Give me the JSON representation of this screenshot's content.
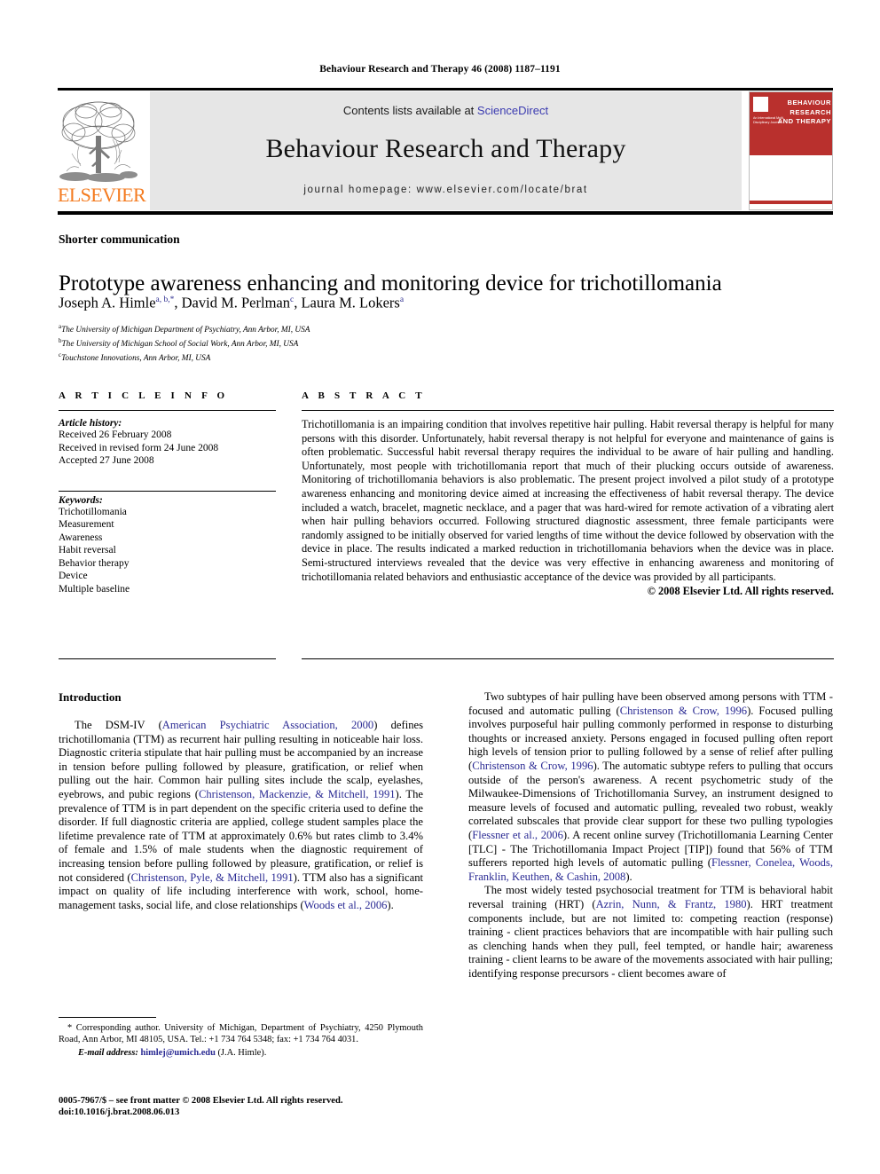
{
  "running_head": "Behaviour Research and Therapy 46 (2008) 1187–1191",
  "masthead": {
    "contents_prefix": "Contents lists available at ",
    "sciencedirect": "ScienceDirect",
    "journal_title": "Behaviour Research and Therapy",
    "homepage": "journal homepage: www.elsevier.com/locate/brat",
    "publisher_wordmark": "ELSEVIER",
    "cover_title": "BEHAVIOUR RESEARCH AND THERAPY",
    "cover_sub": "An International Multi-Disciplinary Journal",
    "colors": {
      "cover_red": "#b9302d",
      "elsevier_orange": "#F47B20",
      "link_blue": "#3b3bb0",
      "panel_gray": "#e6e6e6"
    }
  },
  "article": {
    "section_kind": "Shorter communication",
    "title": "Prototype awareness enhancing and monitoring device for trichotillomania",
    "authors_html": "Joseph A. Himle<sup>a, b,</sup><sup>*</sup>, David M. Perlman<sup>c</sup>, Laura M. Lokers<sup>a</sup>",
    "affiliations": [
      {
        "marker": "a",
        "text": "The University of Michigan Department of Psychiatry, Ann Arbor, MI, USA"
      },
      {
        "marker": "b",
        "text": "The University of Michigan School of Social Work, Ann Arbor, MI, USA"
      },
      {
        "marker": "c",
        "text": "Touchstone Innovations, Ann Arbor, MI, USA"
      }
    ]
  },
  "article_info": {
    "heading": "A R T I C L E    I N F O",
    "history_label": "Article history:",
    "history": [
      "Received 26 February 2008",
      "Received in revised form 24 June 2008",
      "Accepted 27 June 2008"
    ],
    "keywords_label": "Keywords:",
    "keywords": [
      "Trichotillomania",
      "Measurement",
      "Awareness",
      "Habit reversal",
      "Behavior therapy",
      "Device",
      "Multiple baseline"
    ]
  },
  "abstract": {
    "heading": "A B S T R A C T",
    "text": "Trichotillomania is an impairing condition that involves repetitive hair pulling. Habit reversal therapy is helpful for many persons with this disorder. Unfortunately, habit reversal therapy is not helpful for everyone and maintenance of gains is often problematic. Successful habit reversal therapy requires the individual to be aware of hair pulling and handling. Unfortunately, most people with trichotillomania report that much of their plucking occurs outside of awareness. Monitoring of trichotillomania behaviors is also problematic. The present project involved a pilot study of a prototype awareness enhancing and monitoring device aimed at increasing the effectiveness of habit reversal therapy. The device included a watch, bracelet, magnetic necklace, and a pager that was hard-wired for remote activation of a vibrating alert when hair pulling behaviors occurred. Following structured diagnostic assessment, three female participants were randomly assigned to be initially observed for varied lengths of time without the device followed by observation with the device in place. The results indicated a marked reduction in trichotillomania behaviors when the device was in place. Semi-structured interviews revealed that the device was very effective in enhancing awareness and monitoring of trichotillomania related behaviors and enthusiastic acceptance of the device was provided by all participants.",
    "copyright": "© 2008 Elsevier Ltd. All rights reserved."
  },
  "body": {
    "intro_heading": "Introduction",
    "left_paragraphs": [
      {
        "parts": [
          {
            "t": "The DSM-IV (",
            "c": false
          },
          {
            "t": "American Psychiatric Association, 2000",
            "c": true
          },
          {
            "t": ") defines trichotillomania (TTM) as recurrent hair pulling resulting in noticeable hair loss. Diagnostic criteria stipulate that hair pulling must be accompanied by an increase in tension before pulling followed by pleasure, gratification, or relief when pulling out the hair. Common hair pulling sites include the scalp, eyelashes, eyebrows, and pubic regions (",
            "c": false
          },
          {
            "t": "Christenson, Mackenzie, & Mitchell, 1991",
            "c": true
          },
          {
            "t": "). The prevalence of TTM is in part dependent on the specific criteria used to define the disorder. If full diagnostic criteria are applied, college student samples place the lifetime prevalence rate of TTM at approximately 0.6% but rates climb to 3.4% of female and 1.5% of male students when the diagnostic requirement of increasing tension before pulling followed by pleasure, gratification, or relief is not considered (",
            "c": false
          },
          {
            "t": "Christenson, Pyle, & Mitchell, 1991",
            "c": true
          },
          {
            "t": "). TTM also has a significant impact on quality of life including interference with work, school, home-management tasks, social life, and close relationships (",
            "c": false
          },
          {
            "t": "Woods et al., 2006",
            "c": true
          },
          {
            "t": ").",
            "c": false
          }
        ]
      }
    ],
    "right_paragraphs": [
      {
        "parts": [
          {
            "t": "Two subtypes of hair pulling have been observed among persons with TTM - focused and automatic pulling (",
            "c": false
          },
          {
            "t": "Christenson & Crow, 1996",
            "c": true
          },
          {
            "t": "). Focused pulling involves purposeful hair pulling commonly performed in response to disturbing thoughts or increased anxiety. Persons engaged in focused pulling often report high levels of tension prior to pulling followed by a sense of relief after pulling (",
            "c": false
          },
          {
            "t": "Christenson & Crow, 1996",
            "c": true
          },
          {
            "t": "). The automatic subtype refers to pulling that occurs outside of the person's awareness. A recent psychometric study of the Milwaukee-Dimensions of Trichotillomania Survey, an instrument designed to measure levels of focused and automatic pulling, revealed two robust, weakly correlated subscales that provide clear support for these two pulling typologies (",
            "c": false
          },
          {
            "t": "Flessner et al., 2006",
            "c": true
          },
          {
            "t": "). A recent online survey (Trichotillomania Learning Center [TLC] - The Trichotillomania Impact Project [TIP]) found that 56% of TTM sufferers reported high levels of automatic pulling (",
            "c": false
          },
          {
            "t": "Flessner, Conelea, Woods, Franklin, Keuthen, & Cashin, 2008",
            "c": true
          },
          {
            "t": ").",
            "c": false
          }
        ]
      },
      {
        "parts": [
          {
            "t": "The most widely tested psychosocial treatment for TTM is behavioral habit reversal training (HRT) (",
            "c": false
          },
          {
            "t": "Azrin, Nunn, & Frantz, 1980",
            "c": true
          },
          {
            "t": "). HRT treatment components include, but are not limited to: competing reaction (response) training - client practices behaviors that are incompatible with hair pulling such as clenching hands when they pull, feel tempted, or handle hair; awareness training - client learns to be aware of the movements associated with hair pulling; identifying response precursors - client becomes aware of",
            "c": false
          }
        ]
      }
    ]
  },
  "footer": {
    "corresponding_marker": "*",
    "corresponding_text": "Corresponding author. University of Michigan, Department of Psychiatry, 4250 Plymouth Road, Ann Arbor, MI 48105, USA. Tel.: +1 734 764 5348; fax: +1 734 764 4031.",
    "email_label": "E-mail address:",
    "email": "himlej@umich.edu",
    "email_owner": "(J.A. Himle).",
    "issn_line": "0005-7967/$ – see front matter © 2008 Elsevier Ltd. All rights reserved.",
    "doi_line": "doi:10.1016/j.brat.2008.06.013"
  }
}
